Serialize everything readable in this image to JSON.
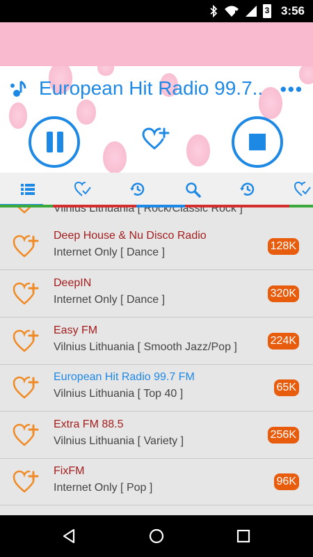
{
  "status_bar": {
    "time": "3:56",
    "battery_level": "3",
    "icons": [
      "bluetooth-icon",
      "wifi-icon",
      "signal-icon",
      "battery-icon"
    ]
  },
  "player": {
    "station_title": "European Hit Radio 99.7 FM",
    "display_title": "European Hit Radio 99.7..",
    "more_label": "•••",
    "icons": [
      "music-note-icon",
      "pause-icon",
      "favorite-add-icon",
      "stop-icon"
    ]
  },
  "tabs": [
    {
      "name": "list",
      "icon": "list-icon"
    },
    {
      "name": "favorites",
      "icon": "heart-check-icon"
    },
    {
      "name": "history",
      "icon": "history-icon"
    },
    {
      "name": "search",
      "icon": "search-icon"
    },
    {
      "name": "recent",
      "icon": "history-icon"
    },
    {
      "name": "favorites2",
      "icon": "heart-check-icon"
    }
  ],
  "stations": [
    {
      "name": "",
      "info": "Vilnius Lithuania [ Rock/Classic Rock ]",
      "bitrate": "",
      "active": false
    },
    {
      "name": "Deep House & Nu Disco Radio",
      "info": "Internet Only [ Dance ]",
      "bitrate": "128K",
      "active": false
    },
    {
      "name": "DeepIN",
      "info": "Internet Only [ Dance ]",
      "bitrate": "320K",
      "active": false
    },
    {
      "name": "Easy FM",
      "info": "Vilnius Lithuania [ Smooth Jazz/Pop ]",
      "bitrate": "224K",
      "active": false
    },
    {
      "name": "European Hit Radio 99.7 FM",
      "info": "Vilnius Lithuania [ Top 40 ]",
      "bitrate": "65K",
      "active": true
    },
    {
      "name": "Extra FM 88.5",
      "info": "Vilnius Lithuania [ Variety ]",
      "bitrate": "256K",
      "active": false
    },
    {
      "name": "FixFM",
      "info": "Internet Only [ Pop ]",
      "bitrate": "96K",
      "active": false
    }
  ],
  "colors": {
    "accent": "#1e88e5",
    "station_name": "#a31d1d",
    "badge": "#e85c0d",
    "heart": "#f08a24",
    "banner": "#f9b9cf"
  }
}
